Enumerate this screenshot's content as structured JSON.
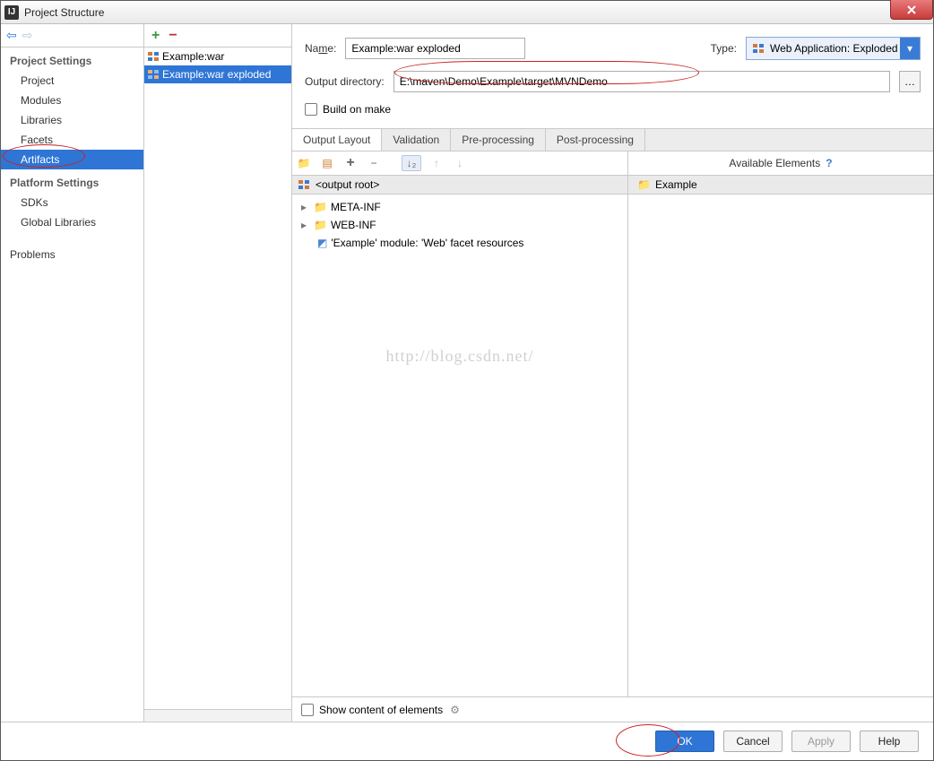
{
  "window": {
    "title": "Project Structure"
  },
  "nav": {
    "groups": [
      {
        "label": "Project Settings",
        "items": [
          "Project",
          "Modules",
          "Libraries",
          "Facets",
          "Artifacts"
        ],
        "selected": "Artifacts"
      },
      {
        "label": "Platform Settings",
        "items": [
          "SDKs",
          "Global Libraries"
        ]
      }
    ],
    "problems": "Problems"
  },
  "artifacts_list": {
    "items": [
      {
        "label": "Example:war"
      },
      {
        "label": "Example:war exploded",
        "selected": true
      }
    ]
  },
  "form": {
    "name_label_prefix": "Na",
    "name_label_ul": "m",
    "name_label_suffix": "e:",
    "name_value": "Example:war exploded",
    "type_label": "Type:",
    "type_value": "Web Application: Exploded",
    "outdir_label": "Output directory:",
    "outdir_value": "E:\\maven\\Demo\\Example\\target\\MVNDemo",
    "build_on_make_prefix": "",
    "build_on_make_ul": "B",
    "build_on_make_suffix": "uild on make"
  },
  "tabs": [
    "Output Layout",
    "Validation",
    "Pre-processing",
    "Post-processing"
  ],
  "active_tab": "Output Layout",
  "tree": {
    "root_label": "<output root>",
    "nodes": [
      {
        "type": "folder",
        "label": "META-INF",
        "expandable": true
      },
      {
        "type": "folder",
        "label": "WEB-INF",
        "expandable": true
      },
      {
        "type": "res",
        "label": "'Example' module: 'Web' facet resources"
      }
    ]
  },
  "available": {
    "header": "Available Elements",
    "items": [
      "Example"
    ]
  },
  "show_row": {
    "label": "Show content of elements"
  },
  "buttons": {
    "ok": "OK",
    "cancel": "Cancel",
    "apply": "Apply",
    "help": "Help"
  },
  "watermark": "http://blog.csdn.net/"
}
